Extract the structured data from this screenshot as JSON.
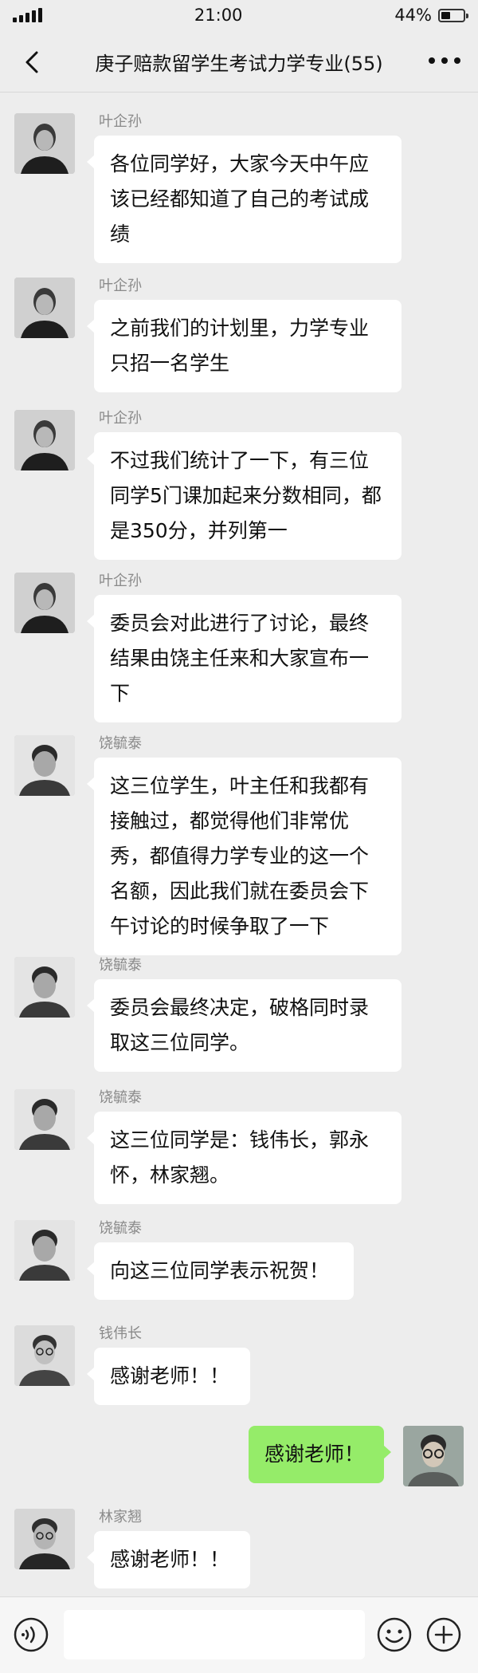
{
  "status_bar": {
    "time": "21:00",
    "battery": "44%",
    "battery_level": 0.44
  },
  "nav": {
    "title": "庚子赔款留学生考试力学专业(55)"
  },
  "messages": [
    {
      "sender": "叶企孙",
      "text": "各位同学好，大家今天中午应该已经都知道了自己的考试成绩",
      "side": "left"
    },
    {
      "sender": "叶企孙",
      "text": "之前我们的计划里，力学专业只招一名学生",
      "side": "left"
    },
    {
      "sender": "叶企孙",
      "text": "不过我们统计了一下，有三位同学5门课加起来分数相同，都是350分，并列第一",
      "side": "left"
    },
    {
      "sender": "叶企孙",
      "text": "委员会对此进行了讨论，最终结果由饶主任来和大家宣布一下",
      "side": "left"
    },
    {
      "sender": "饶毓泰",
      "text": "这三位学生，叶主任和我都有接触过，都觉得他们非常优秀，都值得力学专业的这一个名额，因此我们就在委员会下午讨论的时候争取了一下",
      "side": "left"
    },
    {
      "sender": "饶毓泰",
      "text": "委员会最终决定，破格同时录取这三位同学。",
      "side": "left"
    },
    {
      "sender": "饶毓泰",
      "text": "这三位同学是：钱伟长，郭永怀，林家翘。",
      "side": "left"
    },
    {
      "sender": "饶毓泰",
      "text": "向这三位同学表示祝贺！",
      "side": "left"
    },
    {
      "sender": "钱伟长",
      "text": "感谢老师！！",
      "side": "left"
    },
    {
      "sender": "",
      "text": "感谢老师！",
      "side": "right"
    },
    {
      "sender": "林家翘",
      "text": "感谢老师！！",
      "side": "left"
    }
  ],
  "input": {
    "placeholder": ""
  },
  "colors": {
    "bg": "#ededed",
    "bubble_self": "#95ec69",
    "bubble_other": "#ffffff"
  }
}
